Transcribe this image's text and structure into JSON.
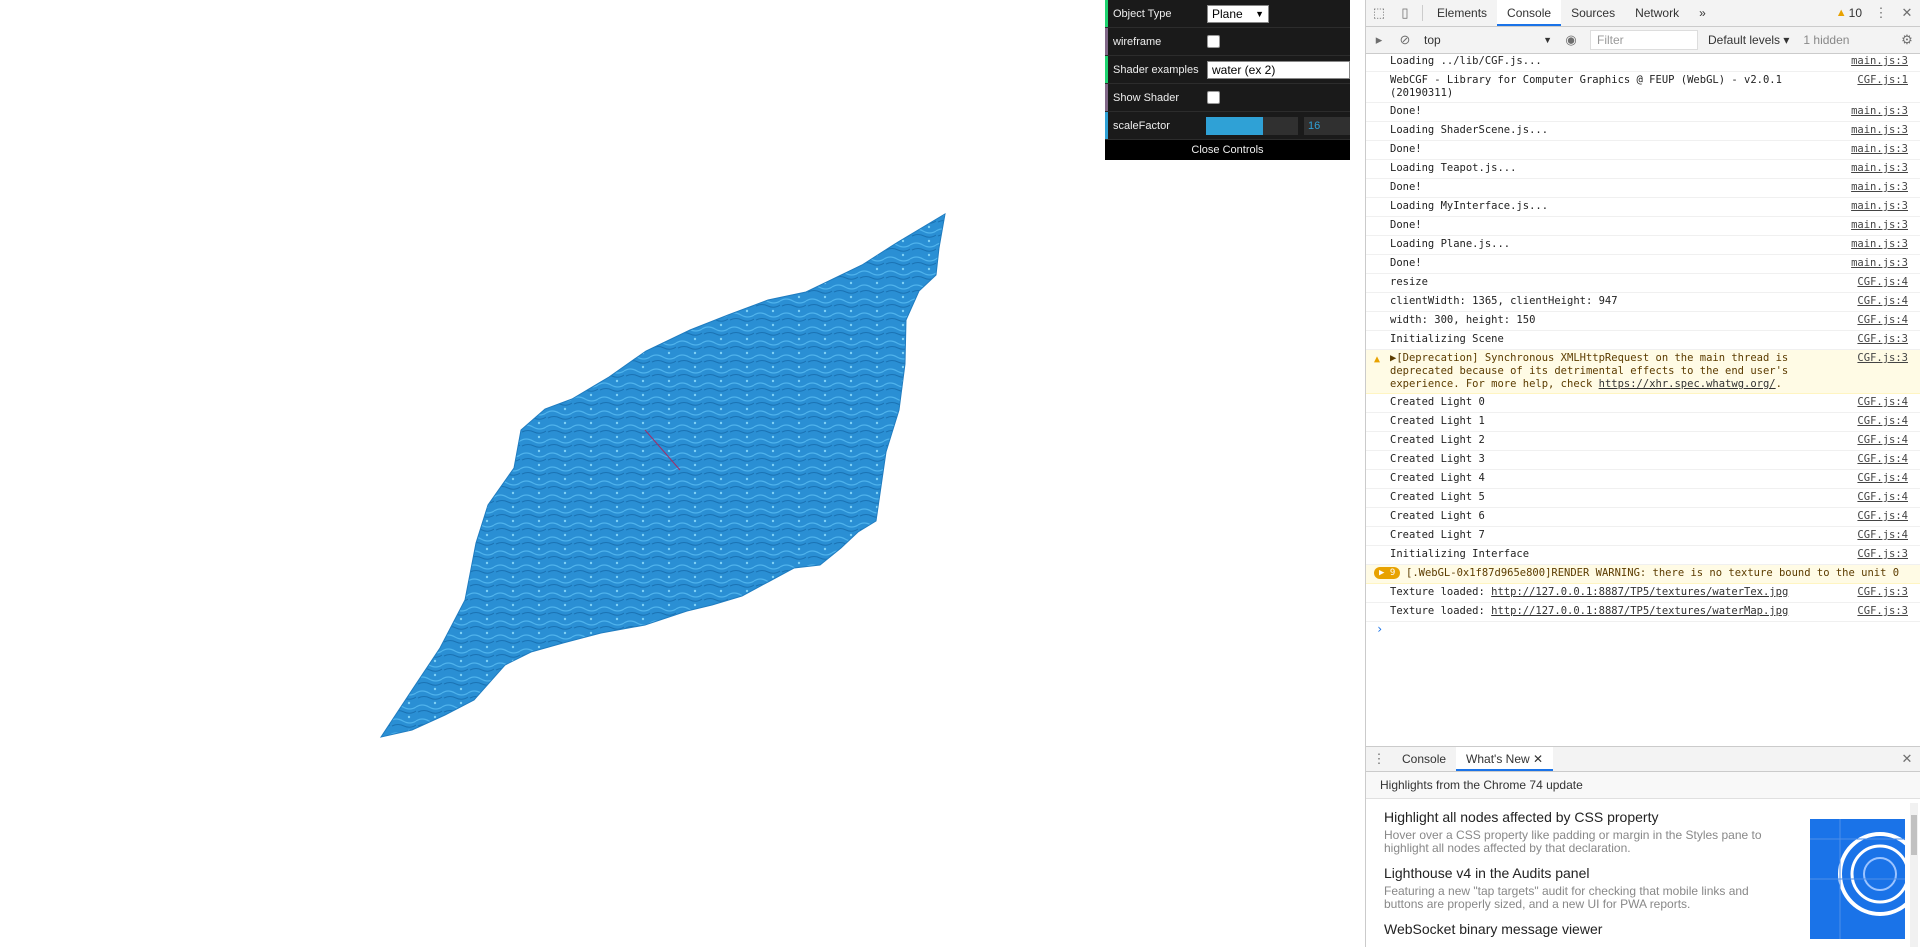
{
  "gui": {
    "rows": [
      {
        "label": "Object Type",
        "value": "Plane"
      },
      {
        "label": "wireframe",
        "checked": false
      },
      {
        "label": "Shader examples",
        "value": "water (ex 2)"
      },
      {
        "label": "Show Shader",
        "checked": false
      },
      {
        "label": "scaleFactor",
        "value": "16",
        "fraction": 0.62
      }
    ],
    "close_label": "Close Controls"
  },
  "devtools": {
    "tabs": [
      "Elements",
      "Console",
      "Sources",
      "Network"
    ],
    "active_tab": "Console",
    "more": "»",
    "warn_count": "10",
    "toolbar": {
      "context": "top",
      "filter_placeholder": "Filter",
      "levels": "Default levels",
      "hidden": "1 hidden"
    },
    "console": [
      {
        "msg": "Loading ../lib/CGF.js...",
        "src": "main.js:3"
      },
      {
        "msg": "WebCGF - Library for Computer Graphics @ FEUP (WebGL) - v2.0.1 (20190311)",
        "src": "CGF.js:1"
      },
      {
        "msg": "Done!",
        "src": "main.js:3"
      },
      {
        "msg": "Loading ShaderScene.js...",
        "src": "main.js:3"
      },
      {
        "msg": "Done!",
        "src": "main.js:3"
      },
      {
        "msg": "Loading Teapot.js...",
        "src": "main.js:3"
      },
      {
        "msg": "Done!",
        "src": "main.js:3"
      },
      {
        "msg": "Loading MyInterface.js...",
        "src": "main.js:3"
      },
      {
        "msg": "Done!",
        "src": "main.js:3"
      },
      {
        "msg": "Loading Plane.js...",
        "src": "main.js:3"
      },
      {
        "msg": "Done!",
        "src": "main.js:3"
      },
      {
        "msg": "resize",
        "src": "CGF.js:4"
      },
      {
        "msg": "clientWidth: 1365, clientHeight: 947",
        "src": "CGF.js:4"
      },
      {
        "msg": "width: 300, height: 150",
        "src": "CGF.js:4"
      },
      {
        "msg": "Initializing Scene",
        "src": "CGF.js:3"
      }
    ],
    "deprecation": {
      "msg": "▶[Deprecation] Synchronous XMLHttpRequest on the main thread is deprecated because of its detrimental effects to the end user's experience. For more help, check ",
      "link": "https://xhr.spec.whatwg.org/",
      "src": "CGF.js:3"
    },
    "console2": [
      {
        "msg": "Created Light 0",
        "src": "CGF.js:4"
      },
      {
        "msg": "Created Light 1",
        "src": "CGF.js:4"
      },
      {
        "msg": "Created Light 2",
        "src": "CGF.js:4"
      },
      {
        "msg": "Created Light 3",
        "src": "CGF.js:4"
      },
      {
        "msg": "Created Light 4",
        "src": "CGF.js:4"
      },
      {
        "msg": "Created Light 5",
        "src": "CGF.js:4"
      },
      {
        "msg": "Created Light 6",
        "src": "CGF.js:4"
      },
      {
        "msg": "Created Light 7",
        "src": "CGF.js:4"
      },
      {
        "msg": "Initializing Interface",
        "src": "CGF.js:3"
      }
    ],
    "webgl_warn": {
      "count": "▶ 9",
      "msg": "[.WebGL-0x1f87d965e800]RENDER WARNING: there is no texture bound to the unit 0"
    },
    "textures": [
      {
        "prefix": "Texture loaded: ",
        "link": "http://127.0.0.1:8887/TP5/textures/waterTex.jpg",
        "src": "CGF.js:3"
      },
      {
        "prefix": "Texture loaded: ",
        "link": "http://127.0.0.1:8887/TP5/textures/waterMap.jpg",
        "src": "CGF.js:3"
      }
    ],
    "prompt": "›",
    "drawer": {
      "tabs": [
        "Console",
        "What's New"
      ],
      "active_tab": "What's New",
      "highlights": "Highlights from the Chrome 74 update",
      "items": [
        {
          "title": "Highlight all nodes affected by CSS property",
          "desc": "Hover over a CSS property like padding or margin in the Styles pane to highlight all nodes affected by that declaration."
        },
        {
          "title": "Lighthouse v4 in the Audits panel",
          "desc": "Featuring a new \"tap targets\" audit for checking that mobile links and buttons are properly sized, and a new UI for PWA reports."
        },
        {
          "title": "WebSocket binary message viewer",
          "desc": ""
        }
      ]
    }
  },
  "colors": {
    "water": "#2a8fd4",
    "accent": "#1a73e8",
    "warning": "#e8a200"
  }
}
